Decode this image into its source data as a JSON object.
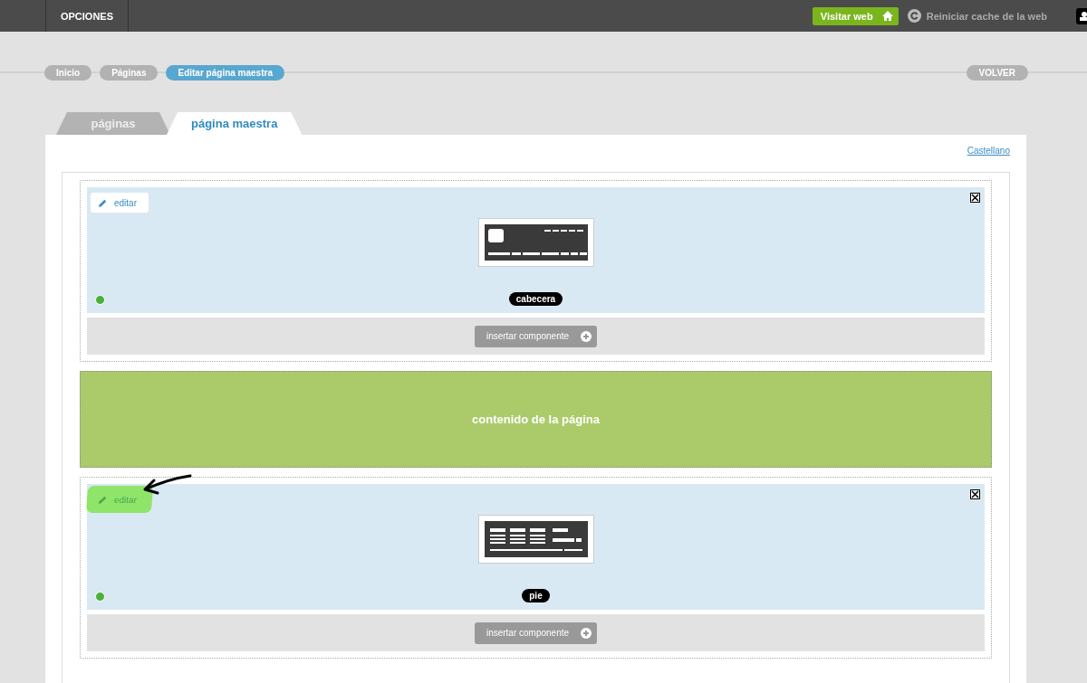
{
  "topbar": {
    "menu": "OPCIONES",
    "visit_button": "Visitar web",
    "cache_link": "Reiniciar cache de la web"
  },
  "breadcrumbs": [
    {
      "label": "Inicio",
      "selected": false
    },
    {
      "label": "Páginas",
      "selected": false
    },
    {
      "label": "Editar página maestra",
      "selected": true
    }
  ],
  "back_button": "VOLVER",
  "tabs": [
    {
      "label": "páginas",
      "selected": false
    },
    {
      "label": "página maestra",
      "selected": true
    }
  ],
  "language_link": "Castellano",
  "sections": [
    {
      "kind": "component",
      "edit_button": "editar",
      "highlighted": false,
      "active": true,
      "thumbnail": {
        "kind": "header"
      },
      "label": "cabecera",
      "insert_button": "insertar componente"
    },
    {
      "kind": "content",
      "label": "contenido de la página"
    },
    {
      "kind": "component",
      "edit_button": "editar",
      "highlighted": true,
      "active": true,
      "thumbnail": {
        "kind": "footer"
      },
      "label": "pie",
      "insert_button": "insertar componente"
    }
  ]
}
